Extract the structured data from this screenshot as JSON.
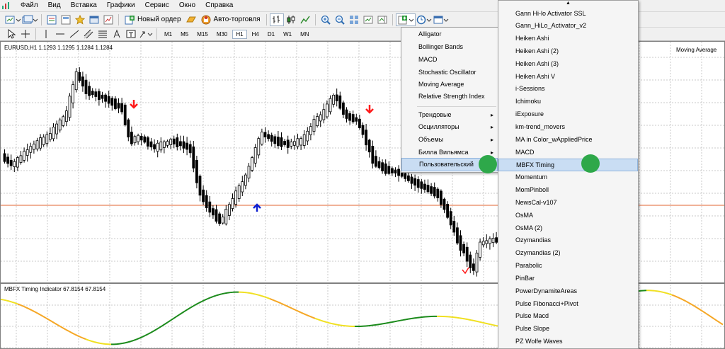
{
  "menubar": {
    "items": [
      "Файл",
      "Вид",
      "Вставка",
      "Графики",
      "Сервис",
      "Окно",
      "Справка"
    ]
  },
  "toolbar": {
    "new_order_label": "Новый ордер",
    "auto_trading_label": "Авто-торговля",
    "timeframes": [
      "M1",
      "M5",
      "M15",
      "M30",
      "H1",
      "H4",
      "D1",
      "W1",
      "MN"
    ],
    "active_timeframe": "H1"
  },
  "chart": {
    "symbol_info": "EURUSD,H1  1.1293 1.1295 1.1284 1.1284",
    "indicator_label": "Moving Average",
    "subwindow_label": "MBFX Timing Indicator 67.8154 67.8154",
    "colors": {
      "bull": "#ffffff",
      "bear": "#000000",
      "grid": "#c8c8c8",
      "level_line": "#e8825a",
      "sell_arrow": "#ff1a1a",
      "buy_arrow": "#1020d0",
      "osc_green": "#1a8a1a",
      "osc_orange": "#f5a623",
      "osc_yellow": "#f0e020"
    }
  },
  "context_menu": {
    "items": [
      {
        "label": "Alligator",
        "submenu": false
      },
      {
        "label": "Bollinger Bands",
        "submenu": false
      },
      {
        "label": "MACD",
        "submenu": false
      },
      {
        "label": "Stochastic Oscillator",
        "submenu": false
      },
      {
        "label": "Moving Average",
        "submenu": false
      },
      {
        "label": "Relative Strength Index",
        "submenu": false
      },
      {
        "label": "Трендовые",
        "submenu": true
      },
      {
        "label": "Осцилляторы",
        "submenu": true
      },
      {
        "label": "Объемы",
        "submenu": true
      },
      {
        "label": "Билла Вильямса",
        "submenu": true
      },
      {
        "label": "Пользовательский",
        "submenu": true
      }
    ],
    "highlighted": "Пользовательский"
  },
  "submenu": {
    "items": [
      "Gann Hi-lo Activator SSL",
      "Gann_HiLo_Activator_v2",
      "Heiken Ashi",
      "Heiken Ashi (2)",
      "Heiken Ashi (3)",
      "Heiken Ashi V",
      "i-Sessions",
      "Ichimoku",
      "iExposure",
      "km-trend_movers",
      "MA in Color_wAppliedPrice",
      "MACD",
      "MBFX Timing",
      "Momentum",
      "MomPinboll",
      "NewsCal-v107",
      "OsMA",
      "OsMA (2)",
      "Ozymandias",
      "Ozymandias (2)",
      "Parabolic",
      "PinBar",
      "PowerDynamiteAreas",
      "Pulse Fibonacci+Pivot",
      "Pulse Macd",
      "Pulse Slope",
      "PZ Wolfe Waves"
    ],
    "highlighted": "MBFX Timing"
  }
}
